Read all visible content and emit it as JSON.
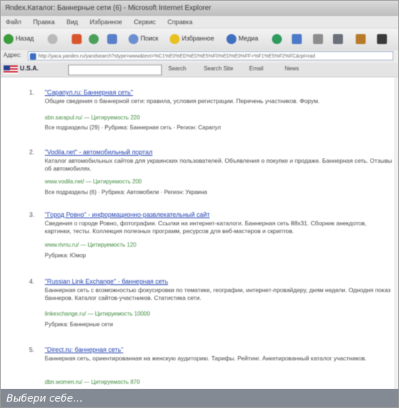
{
  "window": {
    "title": "Яndex.Каталог: Баннерные сети (6) - Microsoft Internet Explorer"
  },
  "menu": {
    "items": [
      "Файл",
      "Правка",
      "Вид",
      "Избранное",
      "Сервис",
      "Справка"
    ]
  },
  "toolbar": {
    "back_label": "Назад",
    "search_label": "Поиск",
    "favorites_label": "Избранное",
    "media_label": "Медиа"
  },
  "address": {
    "label": "Адрес:",
    "url": "http://yaca.yandex.ru/yandsearch?stype=www&text=%C1%E0%ED%ED%E5%F0%ED%E0%FF+%F1%E5%F2%FC&rpt=rad"
  },
  "searchbar": {
    "country": "U.S.A.",
    "buttons": [
      "Search",
      "Search Site",
      "Email",
      "News"
    ]
  },
  "results": [
    {
      "num": "1.",
      "title": "\"Сарапул.ru: Баннерная сеть\"",
      "snippet": "Общие сведения о баннерной сети: правила, условия регистрации. Перечень участников. Форум.",
      "url": "sbn.sarapul.ru/ — Цитируемость 220",
      "meta": "Все подразделы (29) · Рубрика: Баннерная сеть · Регион: Сарапул"
    },
    {
      "num": "2.",
      "title": "\"Vodila.net\" - автомобильный портал",
      "snippet": "Каталог автомобильных сайтов для украинских пользователей. Объявления о покупке и продаже. Баннерная сеть. Отзывы об автомобилях.",
      "url": "www.vodila.net/ — Цитируемость 200",
      "meta": "Все подразделы (6) · Рубрика: Автомобили · Регион: Украина"
    },
    {
      "num": "3.",
      "title": "\"Город Ровно\" - информационно-развлекательный сайт",
      "snippet": "Сведения о городе Ровно, фотографии. Ссылки на интернет-каталоги. Баннерная сеть 88x31. Сборник анекдотов, картинки, тесты. Коллекция полезных программ, ресурсов для веб-мастеров и скриптов.",
      "url": "www.rivnu.ru/ — Цитируемость 120",
      "meta": "Рубрика: Юмор"
    },
    {
      "num": "4.",
      "title": "\"Russian Link Exchange\" - баннерная сеть",
      "snippet": "Баннерная сеть с возможностью фокусировки по тематике, географии, интернет-провайдеру, дням недели. Однодня показ баннеров. Каталог сайтов-участников. Статистика сети.",
      "url": "linkexchange.ru/ — Цитируемость 10000",
      "meta": "Рубрика: Баннерные сети"
    },
    {
      "num": "5.",
      "title": "\"Direct.ru: баннерная сеть\"",
      "snippet": "Баннерная сеть, ориентированная на женскую аудиторию. Тарифы. Рейтинг. Анкетированный каталог участников.",
      "url": "dbn.women.ru/ — Цитируемость 870",
      "meta": ""
    }
  ],
  "caption": {
    "text": "Выбери себе…"
  },
  "colors": {
    "link": "#1f3fb0",
    "url_green": "#3c8a3c",
    "caption_bg": "#838a93"
  }
}
